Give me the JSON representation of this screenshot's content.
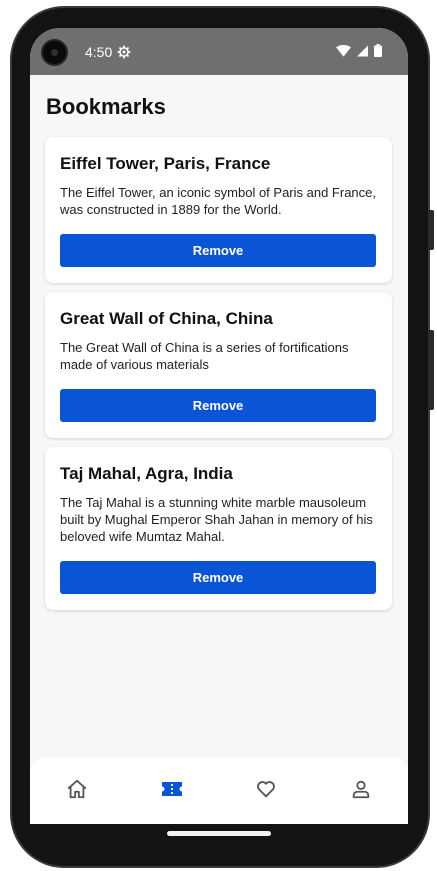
{
  "status_bar": {
    "time": "4:50"
  },
  "page": {
    "title": "Bookmarks"
  },
  "bookmarks": [
    {
      "title": "Eiffel Tower, Paris, France",
      "description": "The Eiffel Tower, an iconic symbol of Paris and France, was constructed in 1889 for the World.",
      "button_label": "Remove"
    },
    {
      "title": "Great Wall of China, China",
      "description": "The Great Wall of China is a series of fortifications made of various materials",
      "button_label": "Remove"
    },
    {
      "title": "Taj Mahal, Agra, India",
      "description": "The Taj Mahal is a stunning white marble mausoleum built by Mughal Emperor Shah Jahan in memory of his beloved wife Mumtaz Mahal.",
      "button_label": "Remove"
    }
  ],
  "bottom_nav": {
    "items": [
      {
        "icon": "home-icon",
        "active": false
      },
      {
        "icon": "ticket-icon",
        "active": true
      },
      {
        "icon": "heart-icon",
        "active": false
      },
      {
        "icon": "profile-icon",
        "active": false
      }
    ],
    "active_color": "#0a55d6",
    "inactive_color": "#555555"
  },
  "colors": {
    "accent": "#0a55d6",
    "status_bar": "#6f6f6f",
    "background": "#f7f7f7"
  }
}
